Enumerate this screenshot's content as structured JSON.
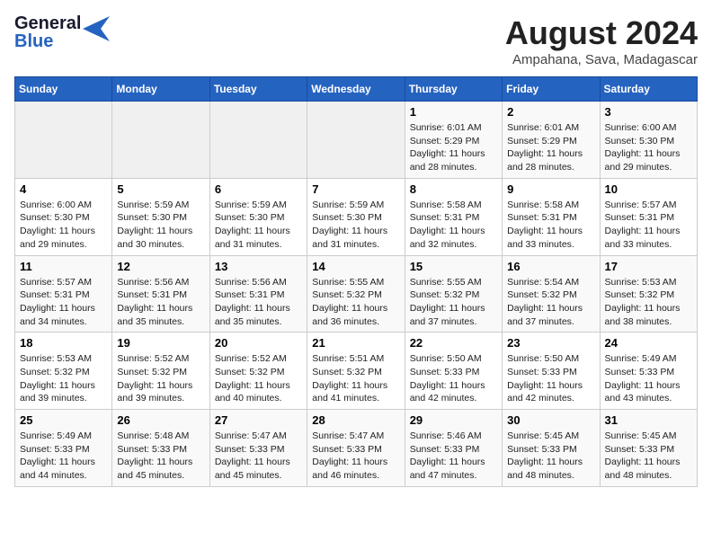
{
  "header": {
    "logo_line1": "General",
    "logo_line2": "Blue",
    "title": "August 2024",
    "subtitle": "Ampahana, Sava, Madagascar"
  },
  "days_of_week": [
    "Sunday",
    "Monday",
    "Tuesday",
    "Wednesday",
    "Thursday",
    "Friday",
    "Saturday"
  ],
  "weeks": [
    [
      {
        "day": "",
        "info": ""
      },
      {
        "day": "",
        "info": ""
      },
      {
        "day": "",
        "info": ""
      },
      {
        "day": "",
        "info": ""
      },
      {
        "day": "1",
        "info": "Sunrise: 6:01 AM\nSunset: 5:29 PM\nDaylight: 11 hours\nand 28 minutes."
      },
      {
        "day": "2",
        "info": "Sunrise: 6:01 AM\nSunset: 5:29 PM\nDaylight: 11 hours\nand 28 minutes."
      },
      {
        "day": "3",
        "info": "Sunrise: 6:00 AM\nSunset: 5:30 PM\nDaylight: 11 hours\nand 29 minutes."
      }
    ],
    [
      {
        "day": "4",
        "info": "Sunrise: 6:00 AM\nSunset: 5:30 PM\nDaylight: 11 hours\nand 29 minutes."
      },
      {
        "day": "5",
        "info": "Sunrise: 5:59 AM\nSunset: 5:30 PM\nDaylight: 11 hours\nand 30 minutes."
      },
      {
        "day": "6",
        "info": "Sunrise: 5:59 AM\nSunset: 5:30 PM\nDaylight: 11 hours\nand 31 minutes."
      },
      {
        "day": "7",
        "info": "Sunrise: 5:59 AM\nSunset: 5:30 PM\nDaylight: 11 hours\nand 31 minutes."
      },
      {
        "day": "8",
        "info": "Sunrise: 5:58 AM\nSunset: 5:31 PM\nDaylight: 11 hours\nand 32 minutes."
      },
      {
        "day": "9",
        "info": "Sunrise: 5:58 AM\nSunset: 5:31 PM\nDaylight: 11 hours\nand 33 minutes."
      },
      {
        "day": "10",
        "info": "Sunrise: 5:57 AM\nSunset: 5:31 PM\nDaylight: 11 hours\nand 33 minutes."
      }
    ],
    [
      {
        "day": "11",
        "info": "Sunrise: 5:57 AM\nSunset: 5:31 PM\nDaylight: 11 hours\nand 34 minutes."
      },
      {
        "day": "12",
        "info": "Sunrise: 5:56 AM\nSunset: 5:31 PM\nDaylight: 11 hours\nand 35 minutes."
      },
      {
        "day": "13",
        "info": "Sunrise: 5:56 AM\nSunset: 5:31 PM\nDaylight: 11 hours\nand 35 minutes."
      },
      {
        "day": "14",
        "info": "Sunrise: 5:55 AM\nSunset: 5:32 PM\nDaylight: 11 hours\nand 36 minutes."
      },
      {
        "day": "15",
        "info": "Sunrise: 5:55 AM\nSunset: 5:32 PM\nDaylight: 11 hours\nand 37 minutes."
      },
      {
        "day": "16",
        "info": "Sunrise: 5:54 AM\nSunset: 5:32 PM\nDaylight: 11 hours\nand 37 minutes."
      },
      {
        "day": "17",
        "info": "Sunrise: 5:53 AM\nSunset: 5:32 PM\nDaylight: 11 hours\nand 38 minutes."
      }
    ],
    [
      {
        "day": "18",
        "info": "Sunrise: 5:53 AM\nSunset: 5:32 PM\nDaylight: 11 hours\nand 39 minutes."
      },
      {
        "day": "19",
        "info": "Sunrise: 5:52 AM\nSunset: 5:32 PM\nDaylight: 11 hours\nand 39 minutes."
      },
      {
        "day": "20",
        "info": "Sunrise: 5:52 AM\nSunset: 5:32 PM\nDaylight: 11 hours\nand 40 minutes."
      },
      {
        "day": "21",
        "info": "Sunrise: 5:51 AM\nSunset: 5:32 PM\nDaylight: 11 hours\nand 41 minutes."
      },
      {
        "day": "22",
        "info": "Sunrise: 5:50 AM\nSunset: 5:33 PM\nDaylight: 11 hours\nand 42 minutes."
      },
      {
        "day": "23",
        "info": "Sunrise: 5:50 AM\nSunset: 5:33 PM\nDaylight: 11 hours\nand 42 minutes."
      },
      {
        "day": "24",
        "info": "Sunrise: 5:49 AM\nSunset: 5:33 PM\nDaylight: 11 hours\nand 43 minutes."
      }
    ],
    [
      {
        "day": "25",
        "info": "Sunrise: 5:49 AM\nSunset: 5:33 PM\nDaylight: 11 hours\nand 44 minutes."
      },
      {
        "day": "26",
        "info": "Sunrise: 5:48 AM\nSunset: 5:33 PM\nDaylight: 11 hours\nand 45 minutes."
      },
      {
        "day": "27",
        "info": "Sunrise: 5:47 AM\nSunset: 5:33 PM\nDaylight: 11 hours\nand 45 minutes."
      },
      {
        "day": "28",
        "info": "Sunrise: 5:47 AM\nSunset: 5:33 PM\nDaylight: 11 hours\nand 46 minutes."
      },
      {
        "day": "29",
        "info": "Sunrise: 5:46 AM\nSunset: 5:33 PM\nDaylight: 11 hours\nand 47 minutes."
      },
      {
        "day": "30",
        "info": "Sunrise: 5:45 AM\nSunset: 5:33 PM\nDaylight: 11 hours\nand 48 minutes."
      },
      {
        "day": "31",
        "info": "Sunrise: 5:45 AM\nSunset: 5:33 PM\nDaylight: 11 hours\nand 48 minutes."
      }
    ]
  ]
}
